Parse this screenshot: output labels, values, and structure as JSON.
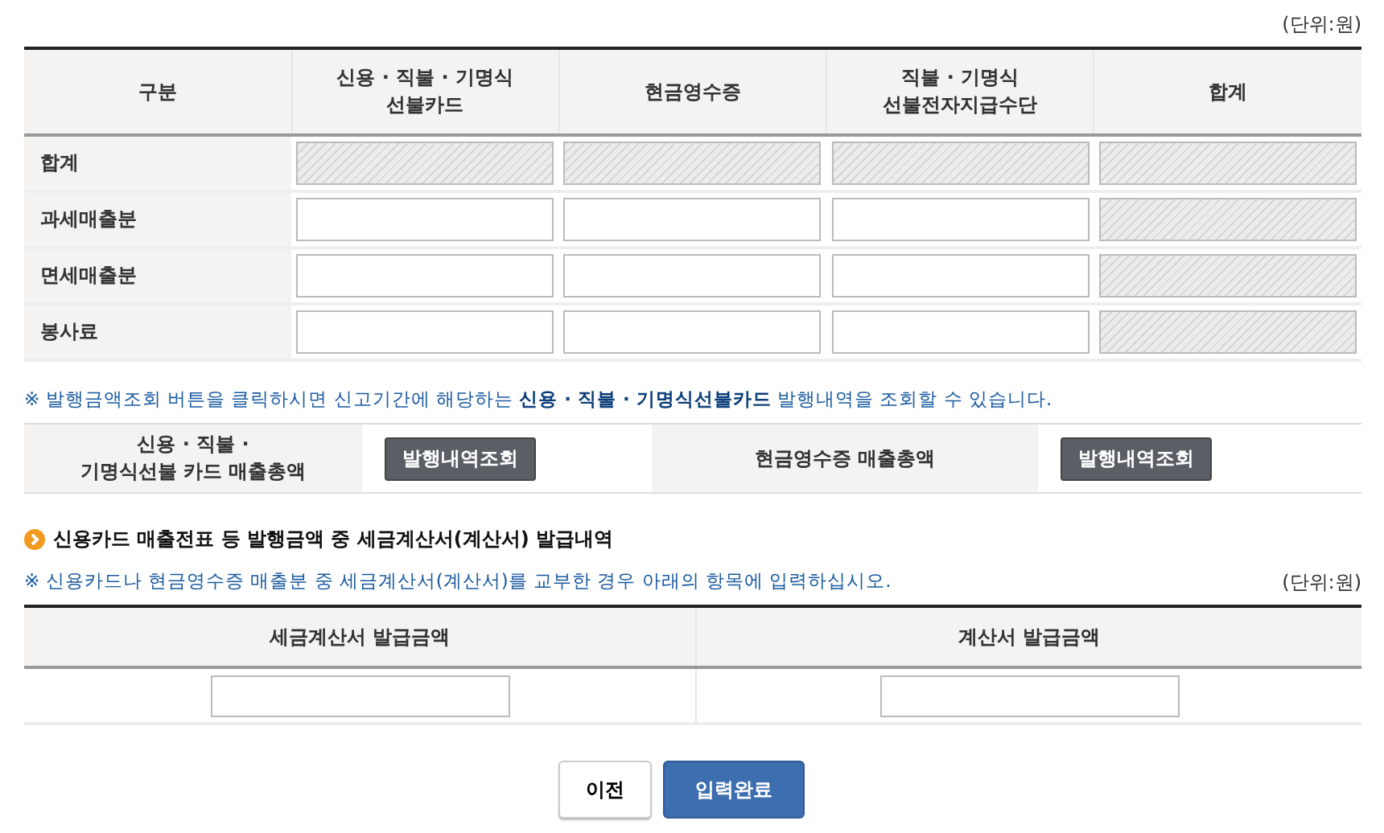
{
  "unit_top": "(단위:원)",
  "table": {
    "columns": [
      "구분",
      "신용 · 직불 · 기명식\n선불카드",
      "현금영수증",
      "직불 · 기명식\n선불전자지급수단",
      "합계"
    ],
    "rows": [
      {
        "label": "합계",
        "cells": [
          {
            "disabled": true
          },
          {
            "disabled": true
          },
          {
            "disabled": true
          },
          {
            "disabled": true
          }
        ]
      },
      {
        "label": "과세매출분",
        "cells": [
          {
            "disabled": false
          },
          {
            "disabled": false
          },
          {
            "disabled": false
          },
          {
            "disabled": true
          }
        ]
      },
      {
        "label": "면세매출분",
        "cells": [
          {
            "disabled": false
          },
          {
            "disabled": false
          },
          {
            "disabled": false
          },
          {
            "disabled": true
          }
        ]
      },
      {
        "label": "봉사료",
        "cells": [
          {
            "disabled": false
          },
          {
            "disabled": false
          },
          {
            "disabled": false
          },
          {
            "disabled": true
          }
        ]
      }
    ]
  },
  "notice": "※ 발행금액조회 버튼을 클릭하시면 신고기간에 해당하는 **신용 · 직불 · 기명식선불카드** 발행내역을 조회할 수 있습니다.",
  "query_row": [
    {
      "label": "신용 · 직불 ·\n기명식선불 카드 매출총액",
      "button": "발행내역조회"
    },
    {
      "label": "현금영수증 매출총액",
      "button": "발행내역조회"
    }
  ],
  "section_title": "신용카드 매출전표 등 발행금액 중 세금계산서(계산서) 발급내역",
  "section_notice": "※ 신용카드나 현금영수증 매출분 중 세금계산서(계산서)를 교부한 경우 아래의 항목에 입력하십시오.",
  "unit_section": "(단위:원)",
  "invoice_table": {
    "columns": [
      "세금계산서 발급금액",
      "계산서 발급금액"
    ]
  },
  "buttons": [
    {
      "label": "이전",
      "kind": "secondary"
    },
    {
      "label": "입력완료",
      "kind": "primary"
    }
  ]
}
